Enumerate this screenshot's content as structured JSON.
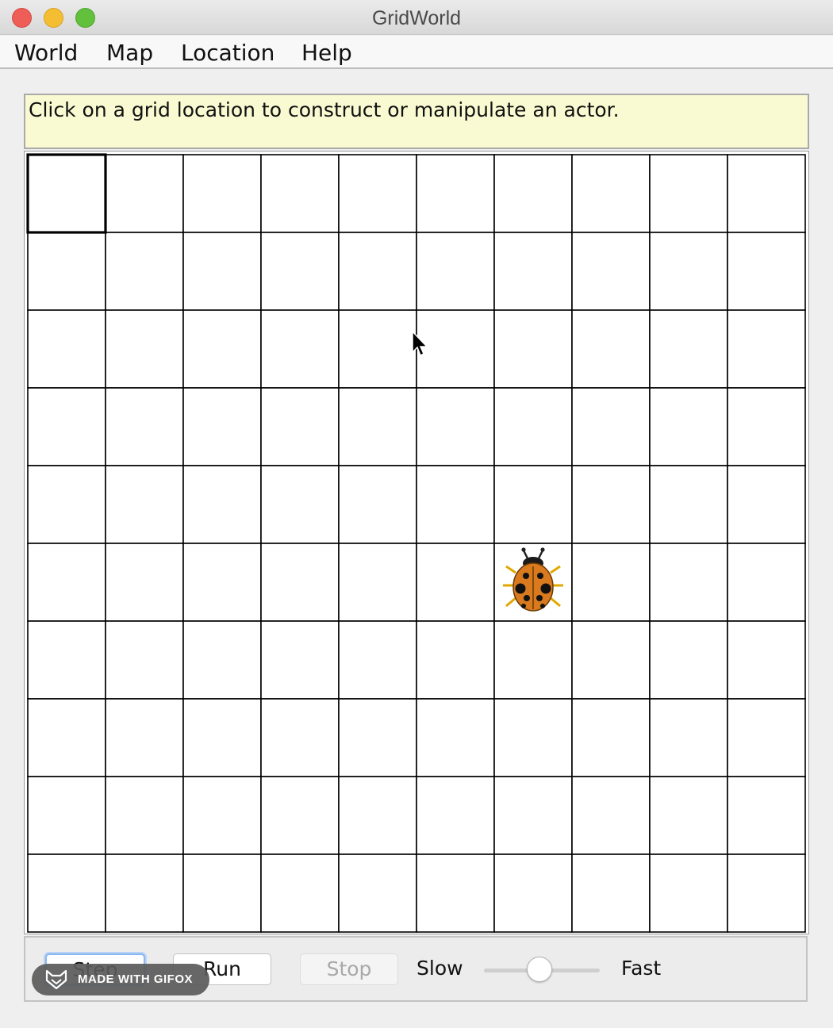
{
  "window": {
    "title": "GridWorld",
    "traffic_lights": {
      "close": "#ee5e57",
      "minimize": "#f5bd31",
      "maximize": "#62c03c"
    }
  },
  "menubar": {
    "items": [
      {
        "label": "World"
      },
      {
        "label": "Map"
      },
      {
        "label": "Location"
      },
      {
        "label": "Help"
      }
    ]
  },
  "message": {
    "text": "Click on a grid location to construct or manipulate an actor."
  },
  "grid": {
    "rows": 10,
    "cols": 10,
    "selected_cell": {
      "row": 0,
      "col": 0
    },
    "actors": [
      {
        "type": "bug",
        "icon": "ladybug-icon",
        "row": 5,
        "col": 6,
        "color": "#d97a1e"
      }
    ]
  },
  "controls": {
    "step_label": "Step",
    "run_label": "Run",
    "stop_label": "Stop",
    "slow_label": "Slow",
    "fast_label": "Fast",
    "speed_fraction": 0.48
  },
  "watermark": {
    "text": "MADE WITH GIFOX",
    "icon": "fox-icon"
  }
}
